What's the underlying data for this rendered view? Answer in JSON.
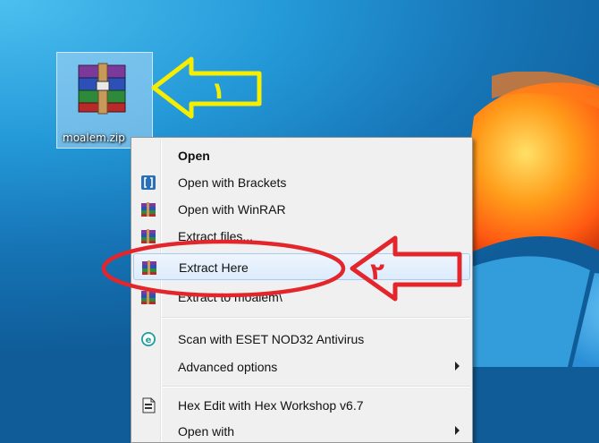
{
  "desktop": {
    "file_icon": {
      "name": "moalem.zip",
      "icon": "winrar-archive-icon"
    },
    "colors": {
      "wallpaper": "#1d86c8",
      "arrow_yellow": "#f5ee00",
      "arrow_red": "#e3262b"
    }
  },
  "annotations": {
    "arrow_1_label": "١",
    "arrow_2_label": "٢"
  },
  "context_menu": {
    "items": [
      {
        "label": "Open",
        "bold": true
      },
      {
        "label": "Open with Brackets",
        "icon": "brackets-icon"
      },
      {
        "label": "Open with WinRAR",
        "icon": "winrar-icon"
      },
      {
        "label": "Extract files...",
        "icon": "winrar-icon"
      },
      {
        "label": "Extract Here",
        "icon": "winrar-icon",
        "highlighted": true
      },
      {
        "label": "Extract to moalem\\",
        "icon": "winrar-icon"
      },
      {
        "label": "Scan with ESET NOD32 Antivirus",
        "icon": "eset-icon"
      },
      {
        "label": "Advanced options",
        "submenu": true
      },
      {
        "label": "Hex Edit with Hex Workshop v6.7",
        "icon": "hex-workshop-icon"
      },
      {
        "label": "Open with",
        "submenu": true
      }
    ]
  }
}
